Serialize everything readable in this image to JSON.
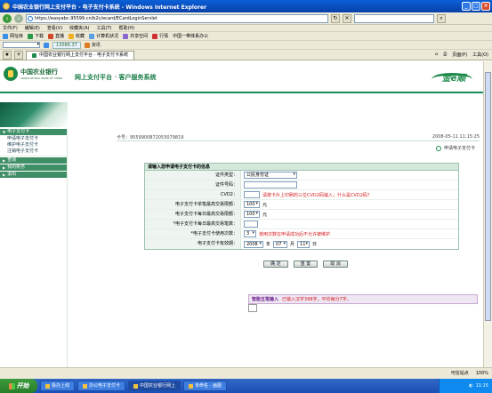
{
  "window": {
    "title": "中国农业银行网上支付平台 - 电子支付卡系统 - Windows Internet Explorer"
  },
  "address": {
    "url": "https://easyabc.95599.cn/b2c/ecard/ECardLoginServlet",
    "search_placeholder": ""
  },
  "menu": {
    "items": [
      "文件(F)",
      "编辑(E)",
      "查看(V)",
      "收藏夹(A)",
      "工具(T)",
      "帮助(H)"
    ]
  },
  "links_bar": {
    "items": [
      "网址库",
      "下载",
      "直播",
      "收藏",
      "计算机状况",
      "共享空间",
      "行情",
      "中国一带体系办公",
      "13086.37",
      "资讯"
    ],
    "stock_value": "13086.37"
  },
  "tabs": {
    "active": "中国农业银行网上支付平台 - 电子支付卡系统",
    "right_items": [
      "页面(P)",
      "工具(O)"
    ]
  },
  "bank": {
    "name_cn": "中国农业银行",
    "name_en": "AGRICULTURAL BANK OF CHINA",
    "platform": "网上支付平台",
    "service": "客户服务系统",
    "brand": "金e顺"
  },
  "sidebar": {
    "sections": [
      {
        "label": "电子支付卡",
        "items": [
          "申请电子支付卡",
          "维护电子支付卡",
          "注销电子支付卡"
        ]
      },
      {
        "label": "查询",
        "items": []
      },
      {
        "label": "我的账务",
        "items": []
      },
      {
        "label": "退出",
        "items": []
      }
    ]
  },
  "content": {
    "card_no": "卡号：955990087205307981​9",
    "date": "2008-05-11 11:15:25",
    "crumb": "申请电子支付卡"
  },
  "form": {
    "title": "请输入您申请电子支付卡的信息",
    "rows": [
      {
        "label": "证件类型：",
        "select": "公民身份证"
      },
      {
        "label": "证件号码：",
        "input": ""
      },
      {
        "label": "CVD2：",
        "hint": "请按卡片上印刷的三位CVD2码输入；什么是CVD2码？"
      },
      {
        "label": "电子支付卡单笔最高交易限额：",
        "select": "100",
        "unit": "元"
      },
      {
        "label": "电子支付卡每日最高交易限额：",
        "select": "100",
        "unit": "元"
      },
      {
        "label": "*电子支付卡每日最高交易笔数：",
        "input": ""
      },
      {
        "label": "*电子支付卡使用次数：",
        "select": "3",
        "hint": "使用次数在申请成功后不允许被维护"
      },
      {
        "label": "电子支付卡有效期：",
        "year": "2008",
        "year_unit": "年",
        "month": "07",
        "month_unit": "月",
        "day": "11",
        "day_unit": "日"
      }
    ],
    "buttons": {
      "confirm": "确 定",
      "reset": "重 置",
      "cancel": "取 消"
    }
  },
  "ime": {
    "text": "智能五笔输入",
    "counter": "已输入汉字398字，平均每分7字。"
  },
  "statusbar": {
    "left": "",
    "zone": "可信站点",
    "zoom": "100%"
  },
  "taskbar": {
    "start": "开始",
    "tasks": [
      "极办上线",
      "办公电子支付卡",
      "中国农业银行网上",
      "未命名 - 画图"
    ],
    "active_index": 2,
    "clock": "11:15"
  }
}
